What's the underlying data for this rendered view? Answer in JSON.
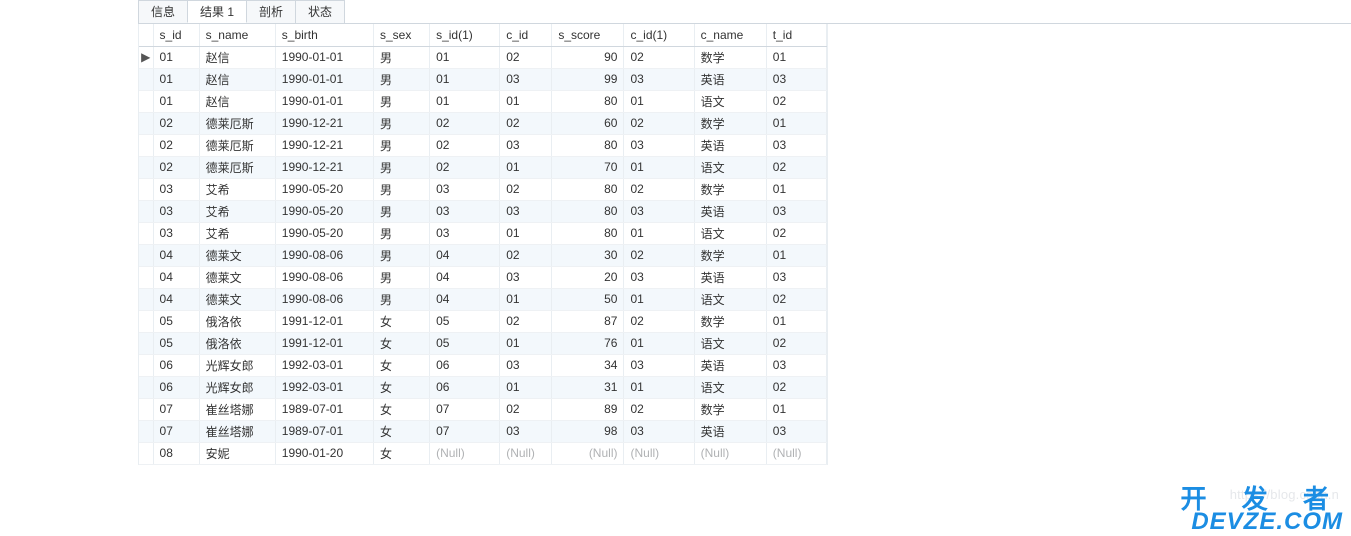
{
  "tabs": [
    {
      "label": "信息",
      "active": false
    },
    {
      "label": "结果 1",
      "active": true
    },
    {
      "label": "剖析",
      "active": false
    },
    {
      "label": "状态",
      "active": false
    }
  ],
  "columns": [
    "s_id",
    "s_name",
    "s_birth",
    "s_sex",
    "s_id(1)",
    "c_id",
    "s_score",
    "c_id(1)",
    "c_name",
    "t_id"
  ],
  "rows": [
    {
      "cursor": true,
      "s_id": "01",
      "s_name": "赵信",
      "s_birth": "1990-01-01",
      "s_sex": "男",
      "s_id1": "01",
      "c_id": "02",
      "s_score": "90",
      "c_id1": "02",
      "c_name": "数学",
      "t_id": "01"
    },
    {
      "cursor": false,
      "s_id": "01",
      "s_name": "赵信",
      "s_birth": "1990-01-01",
      "s_sex": "男",
      "s_id1": "01",
      "c_id": "03",
      "s_score": "99",
      "c_id1": "03",
      "c_name": "英语",
      "t_id": "03"
    },
    {
      "cursor": false,
      "s_id": "01",
      "s_name": "赵信",
      "s_birth": "1990-01-01",
      "s_sex": "男",
      "s_id1": "01",
      "c_id": "01",
      "s_score": "80",
      "c_id1": "01",
      "c_name": "语文",
      "t_id": "02"
    },
    {
      "cursor": false,
      "s_id": "02",
      "s_name": "德莱厄斯",
      "s_birth": "1990-12-21",
      "s_sex": "男",
      "s_id1": "02",
      "c_id": "02",
      "s_score": "60",
      "c_id1": "02",
      "c_name": "数学",
      "t_id": "01"
    },
    {
      "cursor": false,
      "s_id": "02",
      "s_name": "德莱厄斯",
      "s_birth": "1990-12-21",
      "s_sex": "男",
      "s_id1": "02",
      "c_id": "03",
      "s_score": "80",
      "c_id1": "03",
      "c_name": "英语",
      "t_id": "03"
    },
    {
      "cursor": false,
      "s_id": "02",
      "s_name": "德莱厄斯",
      "s_birth": "1990-12-21",
      "s_sex": "男",
      "s_id1": "02",
      "c_id": "01",
      "s_score": "70",
      "c_id1": "01",
      "c_name": "语文",
      "t_id": "02"
    },
    {
      "cursor": false,
      "s_id": "03",
      "s_name": "艾希",
      "s_birth": "1990-05-20",
      "s_sex": "男",
      "s_id1": "03",
      "c_id": "02",
      "s_score": "80",
      "c_id1": "02",
      "c_name": "数学",
      "t_id": "01"
    },
    {
      "cursor": false,
      "s_id": "03",
      "s_name": "艾希",
      "s_birth": "1990-05-20",
      "s_sex": "男",
      "s_id1": "03",
      "c_id": "03",
      "s_score": "80",
      "c_id1": "03",
      "c_name": "英语",
      "t_id": "03"
    },
    {
      "cursor": false,
      "s_id": "03",
      "s_name": "艾希",
      "s_birth": "1990-05-20",
      "s_sex": "男",
      "s_id1": "03",
      "c_id": "01",
      "s_score": "80",
      "c_id1": "01",
      "c_name": "语文",
      "t_id": "02"
    },
    {
      "cursor": false,
      "s_id": "04",
      "s_name": "德莱文",
      "s_birth": "1990-08-06",
      "s_sex": "男",
      "s_id1": "04",
      "c_id": "02",
      "s_score": "30",
      "c_id1": "02",
      "c_name": "数学",
      "t_id": "01"
    },
    {
      "cursor": false,
      "s_id": "04",
      "s_name": "德莱文",
      "s_birth": "1990-08-06",
      "s_sex": "男",
      "s_id1": "04",
      "c_id": "03",
      "s_score": "20",
      "c_id1": "03",
      "c_name": "英语",
      "t_id": "03"
    },
    {
      "cursor": false,
      "s_id": "04",
      "s_name": "德莱文",
      "s_birth": "1990-08-06",
      "s_sex": "男",
      "s_id1": "04",
      "c_id": "01",
      "s_score": "50",
      "c_id1": "01",
      "c_name": "语文",
      "t_id": "02"
    },
    {
      "cursor": false,
      "s_id": "05",
      "s_name": "俄洛依",
      "s_birth": "1991-12-01",
      "s_sex": "女",
      "s_id1": "05",
      "c_id": "02",
      "s_score": "87",
      "c_id1": "02",
      "c_name": "数学",
      "t_id": "01"
    },
    {
      "cursor": false,
      "s_id": "05",
      "s_name": "俄洛依",
      "s_birth": "1991-12-01",
      "s_sex": "女",
      "s_id1": "05",
      "c_id": "01",
      "s_score": "76",
      "c_id1": "01",
      "c_name": "语文",
      "t_id": "02"
    },
    {
      "cursor": false,
      "s_id": "06",
      "s_name": "光辉女郎",
      "s_birth": "1992-03-01",
      "s_sex": "女",
      "s_id1": "06",
      "c_id": "03",
      "s_score": "34",
      "c_id1": "03",
      "c_name": "英语",
      "t_id": "03"
    },
    {
      "cursor": false,
      "s_id": "06",
      "s_name": "光辉女郎",
      "s_birth": "1992-03-01",
      "s_sex": "女",
      "s_id1": "06",
      "c_id": "01",
      "s_score": "31",
      "c_id1": "01",
      "c_name": "语文",
      "t_id": "02"
    },
    {
      "cursor": false,
      "s_id": "07",
      "s_name": "崔丝塔娜",
      "s_birth": "1989-07-01",
      "s_sex": "女",
      "s_id1": "07",
      "c_id": "02",
      "s_score": "89",
      "c_id1": "02",
      "c_name": "数学",
      "t_id": "01"
    },
    {
      "cursor": false,
      "s_id": "07",
      "s_name": "崔丝塔娜",
      "s_birth": "1989-07-01",
      "s_sex": "女",
      "s_id1": "07",
      "c_id": "03",
      "s_score": "98",
      "c_id1": "03",
      "c_name": "英语",
      "t_id": "03"
    },
    {
      "cursor": false,
      "s_id": "08",
      "s_name": "安妮",
      "s_birth": "1990-01-20",
      "s_sex": "女",
      "s_id1": "(Null)",
      "c_id": "(Null)",
      "s_score": "(Null)",
      "c_id1": "(Null)",
      "c_name": "(Null)",
      "t_id": "(Null)"
    }
  ],
  "watermark": {
    "url": "https://blog.csdn.n",
    "cn": "开 发 者",
    "en": "DEVZE.COM"
  },
  "cursor_glyph": "▶"
}
